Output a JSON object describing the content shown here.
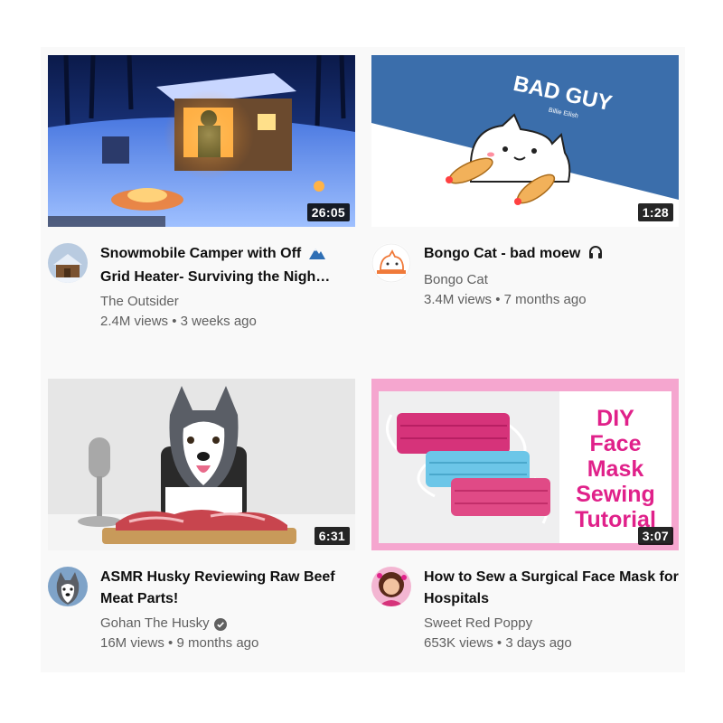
{
  "videos": [
    {
      "title": "Snowmobile Camper with Off ⛰ Grid Heater- Surviving the Night",
      "title_display": "Snowmobile Camper with Off",
      "title_line2": "Grid Heater- Surviving the Nigh…",
      "channel": "The Outsider",
      "views": "2.4M views",
      "age": "3 weeks ago",
      "duration": "26:05",
      "title_icon": "mountain-icon"
    },
    {
      "title": "Bongo Cat - bad moew",
      "channel": "Bongo Cat",
      "views": "3.4M views",
      "age": "7 months ago",
      "duration": "1:28",
      "title_icon": "headphones-icon",
      "thumb_text": "BAD GUY",
      "thumb_subtext": "Billie Eilish"
    },
    {
      "title": "ASMR Husky Reviewing Raw Beef Meat Parts!",
      "channel": "Gohan The Husky",
      "verified": true,
      "views": "16M views",
      "age": "9 months ago",
      "duration": "6:31"
    },
    {
      "title": "How to Sew a Surgical Face Mask for Hospitals",
      "channel": "Sweet Red Poppy",
      "views": "653K views",
      "age": "3 days ago",
      "duration": "3:07",
      "thumb_text": [
        "DIY",
        "Face",
        "Mask",
        "Sewing",
        "Tutorial"
      ]
    }
  ],
  "separator": "•",
  "colors": {
    "title": "#0f0f0f",
    "secondary": "#606060",
    "duration_bg": "#000000",
    "mask_text": "#e0218a",
    "bongo_bg": "#3b6eab"
  }
}
